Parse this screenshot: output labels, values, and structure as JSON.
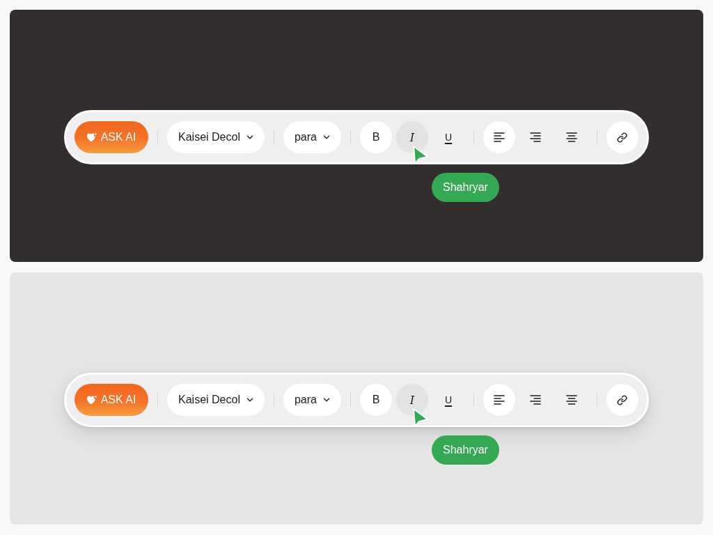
{
  "panels": [
    {
      "dark": true,
      "toolbar": {
        "ask_ai": {
          "label": "ASK AI"
        },
        "font_select": {
          "value": "Kaisei Decol"
        },
        "style_select": {
          "value": "para"
        },
        "format_buttons": [
          {
            "kind": "bold",
            "label": "B",
            "selected": true,
            "hovered": false
          },
          {
            "kind": "italic",
            "label": "I",
            "selected": false,
            "hovered": true
          },
          {
            "kind": "underline",
            "label": "U",
            "selected": false,
            "hovered": false
          }
        ],
        "align_buttons": [
          {
            "kind": "left",
            "selected": true
          },
          {
            "kind": "right",
            "selected": false
          },
          {
            "kind": "center",
            "selected": false
          }
        ],
        "link_button": {
          "selected": true
        }
      },
      "cursor": {
        "name": "Shahryar",
        "color": "#34a853"
      }
    },
    {
      "dark": false,
      "toolbar": {
        "ask_ai": {
          "label": "ASK AI"
        },
        "font_select": {
          "value": "Kaisei Decol"
        },
        "style_select": {
          "value": "para"
        },
        "format_buttons": [
          {
            "kind": "bold",
            "label": "B",
            "selected": true,
            "hovered": false
          },
          {
            "kind": "italic",
            "label": "I",
            "selected": false,
            "hovered": true
          },
          {
            "kind": "underline",
            "label": "U",
            "selected": false,
            "hovered": false
          }
        ],
        "align_buttons": [
          {
            "kind": "left",
            "selected": true
          },
          {
            "kind": "right",
            "selected": false
          },
          {
            "kind": "center",
            "selected": false
          }
        ],
        "link_button": {
          "selected": true
        }
      },
      "cursor": {
        "name": "Shahryar",
        "color": "#34a853"
      }
    }
  ]
}
